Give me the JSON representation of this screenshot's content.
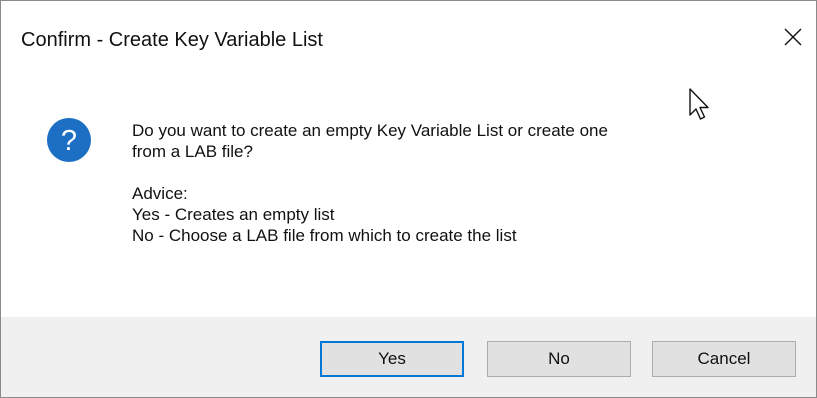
{
  "window": {
    "title": "Confirm - Create Key Variable List",
    "close_icon": "close-icon"
  },
  "message": {
    "icon": "question-icon",
    "icon_color": "#1c6fc2",
    "line1": "Do you want to create an empty Key Variable List or create one",
    "line2": "from a LAB file?",
    "advice_heading": "Advice:",
    "advice_yes": "Yes - Creates an empty list",
    "advice_no": "No - Choose a LAB file from which to create the list"
  },
  "buttons": {
    "yes_label": "Yes",
    "no_label": "No",
    "cancel_label": "Cancel",
    "default_accent": "#0078d7"
  }
}
